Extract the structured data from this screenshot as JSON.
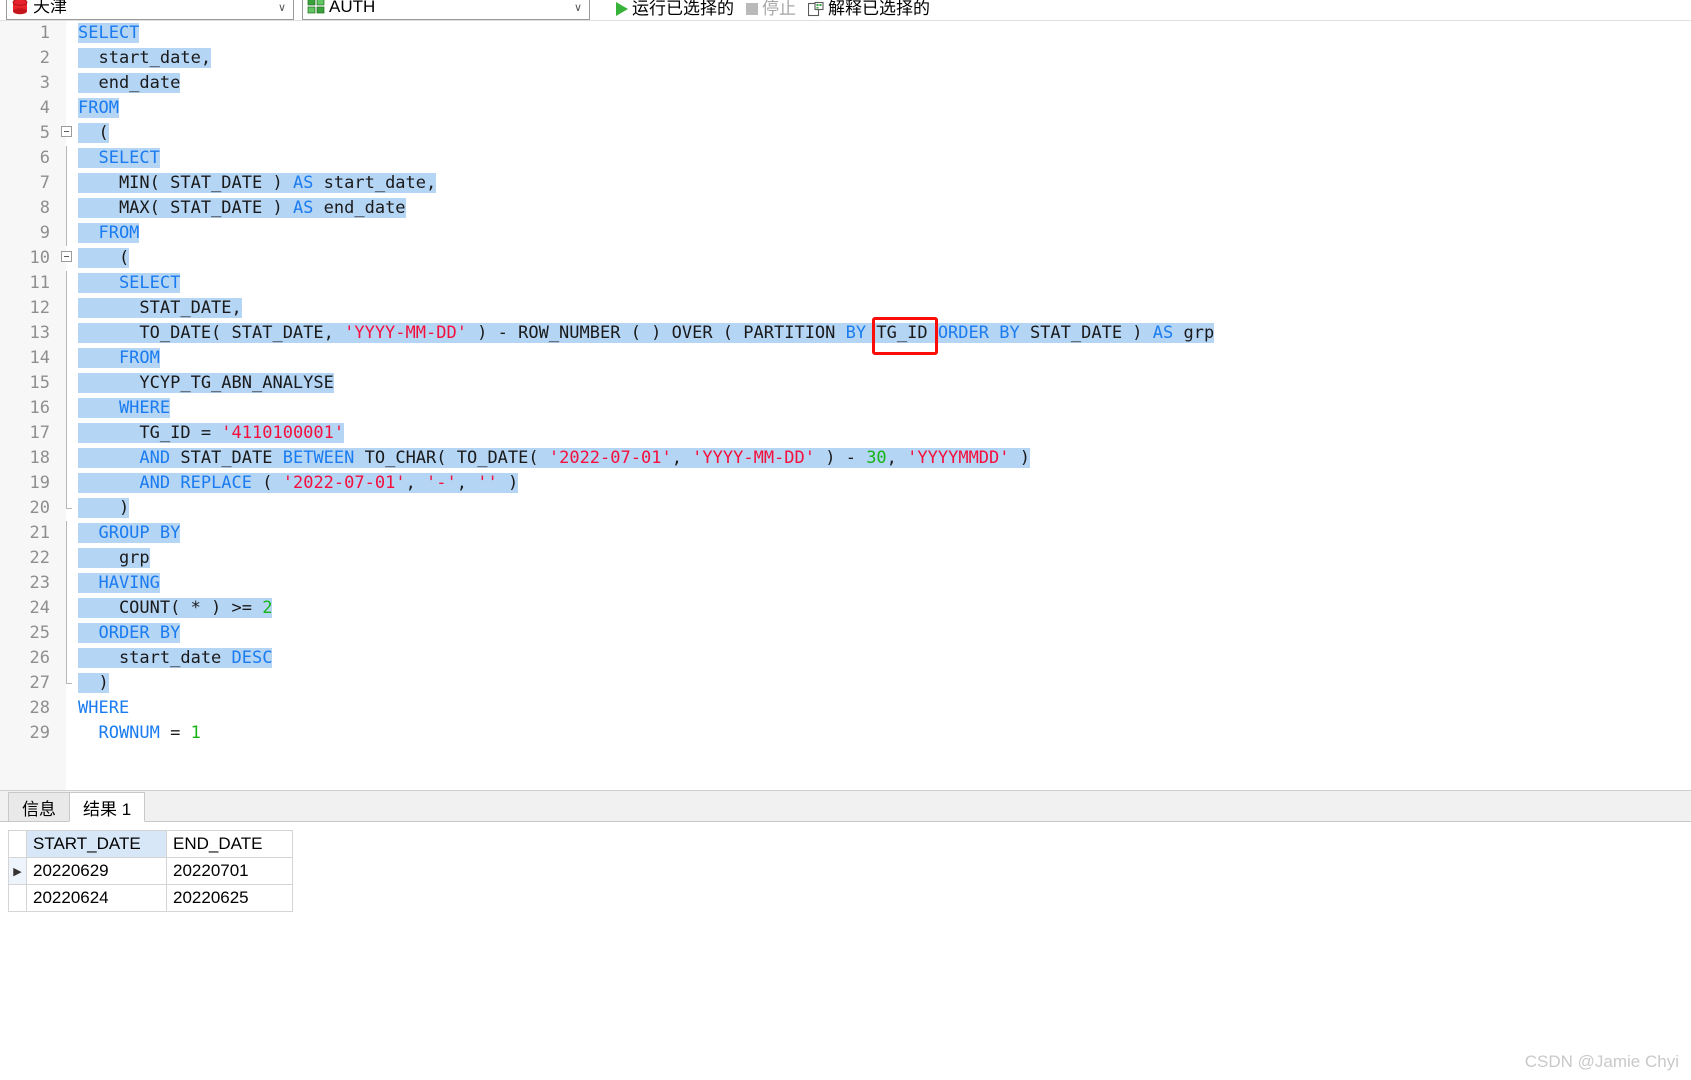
{
  "toolbar": {
    "connection": {
      "label": "天津",
      "icon": "database-red-icon",
      "arrow": "∨"
    },
    "schema": {
      "label": "AUTH",
      "icon": "schema-green-icon",
      "arrow": "∨"
    },
    "run_selected": "运行已选择的",
    "stop": "停止",
    "explain_selected": "解释已选择的"
  },
  "editor": {
    "lines": [
      {
        "n": "1",
        "text": "SELECT"
      },
      {
        "n": "2",
        "text": "  start_date,"
      },
      {
        "n": "3",
        "text": "  end_date"
      },
      {
        "n": "4",
        "text": "FROM"
      },
      {
        "n": "5",
        "text": "  ("
      },
      {
        "n": "6",
        "text": "  SELECT"
      },
      {
        "n": "7",
        "text": "    MIN( STAT_DATE ) AS start_date,"
      },
      {
        "n": "8",
        "text": "    MAX( STAT_DATE ) AS end_date"
      },
      {
        "n": "9",
        "text": "  FROM"
      },
      {
        "n": "10",
        "text": "    ("
      },
      {
        "n": "11",
        "text": "    SELECT"
      },
      {
        "n": "12",
        "text": "      STAT_DATE,"
      },
      {
        "n": "13",
        "text": "      TO_DATE( STAT_DATE, 'YYYY-MM-DD' ) - ROW_NUMBER ( ) OVER ( PARTITION BY TG_ID ORDER BY STAT_DATE ) AS grp"
      },
      {
        "n": "14",
        "text": "    FROM"
      },
      {
        "n": "15",
        "text": "      YCYP_TG_ABN_ANALYSE"
      },
      {
        "n": "16",
        "text": "    WHERE"
      },
      {
        "n": "17",
        "text": "      TG_ID = '4110100001'"
      },
      {
        "n": "18",
        "text": "      AND STAT_DATE BETWEEN TO_CHAR( TO_DATE( '2022-07-01', 'YYYY-MM-DD' ) - 30, 'YYYYMMDD' )"
      },
      {
        "n": "19",
        "text": "      AND REPLACE ( '2022-07-01', '-', '' )"
      },
      {
        "n": "20",
        "text": "    )"
      },
      {
        "n": "21",
        "text": "  GROUP BY"
      },
      {
        "n": "22",
        "text": "    grp"
      },
      {
        "n": "23",
        "text": "  HAVING"
      },
      {
        "n": "24",
        "text": "    COUNT( * ) >= 2"
      },
      {
        "n": "25",
        "text": "  ORDER BY"
      },
      {
        "n": "26",
        "text": "    start_date DESC"
      },
      {
        "n": "27",
        "text": "  )"
      },
      {
        "n": "28",
        "text": "WHERE"
      },
      {
        "n": "29",
        "text": "  ROWNUM = 1"
      }
    ],
    "annotation": {
      "target": "TG_ID",
      "color": "#fb0d09"
    }
  },
  "results": {
    "tabs": [
      {
        "label": "信息",
        "active": false
      },
      {
        "label": "结果 1",
        "active": true
      }
    ],
    "columns": [
      "START_DATE",
      "END_DATE"
    ],
    "rows": [
      {
        "marker": "▶",
        "current": true,
        "cells": [
          "20220629",
          "20220701"
        ]
      },
      {
        "marker": "",
        "current": false,
        "cells": [
          "20220624",
          "20220625"
        ]
      }
    ]
  },
  "watermark": "CSDN @Jamie Chyi"
}
